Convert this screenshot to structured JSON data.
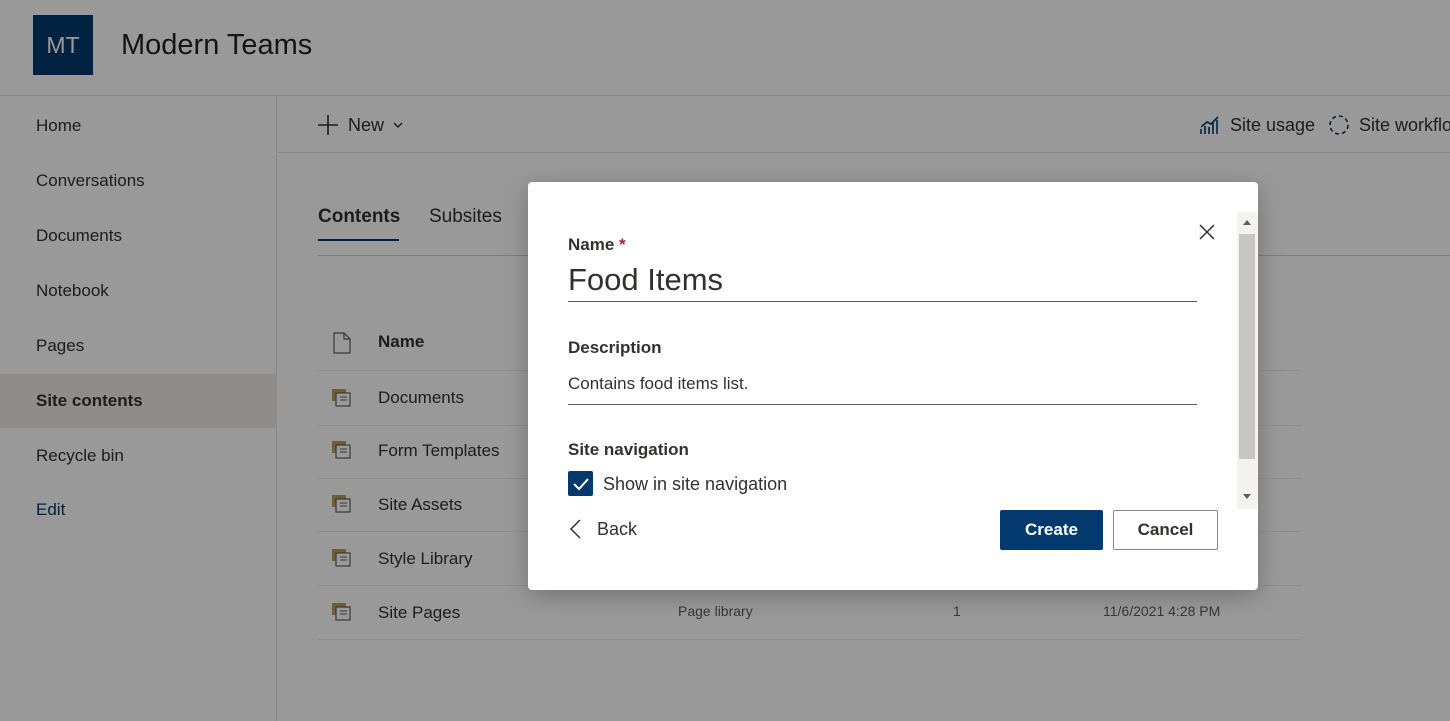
{
  "site": {
    "logo_initials": "MT",
    "title": "Modern Teams"
  },
  "nav": {
    "items": [
      {
        "label": "Home",
        "name": "nav-home"
      },
      {
        "label": "Conversations",
        "name": "nav-conversations"
      },
      {
        "label": "Documents",
        "name": "nav-documents"
      },
      {
        "label": "Notebook",
        "name": "nav-notebook"
      },
      {
        "label": "Pages",
        "name": "nav-pages"
      },
      {
        "label": "Site contents",
        "name": "nav-site-contents",
        "selected": true
      },
      {
        "label": "Recycle bin",
        "name": "nav-recycle-bin"
      }
    ],
    "edit_label": "Edit"
  },
  "commandbar": {
    "new_label": "New",
    "site_usage_label": "Site usage",
    "site_workflows_label": "Site workflo"
  },
  "tabs": [
    {
      "label": "Contents",
      "active": true
    },
    {
      "label": "Subsites",
      "active": false
    }
  ],
  "list": {
    "name_header": "Name",
    "rows": [
      {
        "name": "Documents",
        "type": "",
        "items": "",
        "modified": ""
      },
      {
        "name": "Form Templates",
        "type": "",
        "items": "",
        "modified": ""
      },
      {
        "name": "Site Assets",
        "type": "",
        "items": "",
        "modified": ""
      },
      {
        "name": "Style Library",
        "type": "",
        "items": "",
        "modified": ""
      },
      {
        "name": "Site Pages",
        "type": "Page library",
        "items": "1",
        "modified": "11/6/2021 4:28 PM"
      }
    ]
  },
  "dialog": {
    "name_label": "Name",
    "required_marker": "*",
    "name_value": "Food Items",
    "description_label": "Description",
    "description_value": "Contains food items list.",
    "site_navigation_label": "Site navigation",
    "show_in_nav_label": "Show in site navigation",
    "show_in_nav_checked": true,
    "back_label": "Back",
    "create_label": "Create",
    "cancel_label": "Cancel"
  },
  "colors": {
    "brand": "#03396c",
    "overlay": "rgba(0,0,0,0.4)",
    "required": "#a4262c"
  }
}
